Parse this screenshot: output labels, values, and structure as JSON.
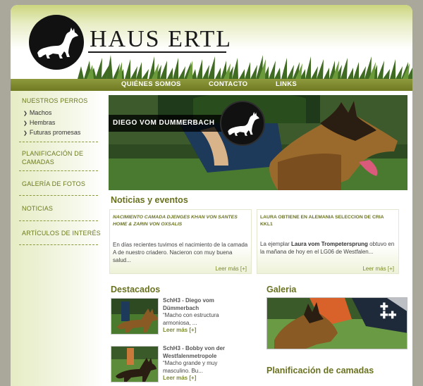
{
  "header": {
    "logo_text": "HAUS ERTL"
  },
  "nav": {
    "items": [
      "QUIÉNES SOMOS",
      "CONTACTO",
      "LINKS"
    ]
  },
  "sidebar": {
    "nuestros_perros": "NUESTROS PERROS",
    "subitems": [
      "Machos",
      "Hembras",
      "Futuras promesas"
    ],
    "planificacion_line1": "PLANIFICACIÓN DE",
    "planificacion_line2": "CAMADAS",
    "galeria": "GALERÍA DE FOTOS",
    "noticias": "NOTICIAS",
    "articulos": "ARTÍCULOS DE INTERÉS"
  },
  "hero": {
    "label": "DIEGO VOM DUMMERBACH"
  },
  "noticias": {
    "heading": "Noticias y eventos",
    "items": [
      {
        "title": "NACIMIENTO CAMADA DJENGES KHAN VON SANTES HOME & ZARIN VON OXSALIS",
        "body": "En días recientes tuvimos el nacimiento de la camada A de nuestro criadero.  Nacieron con muy buena salud...",
        "more": "Leer más [+]"
      },
      {
        "title": "LAURA OBTIENE EN ALEMANIA SELECCION DE CRIA KKL1",
        "body_pre": "La ejemplar ",
        "body_bold": "Laura vom Trompetersprung",
        "body_post": " obtuvo en la mañana de hoy en el LG06 de Westfalen...",
        "more": "Leer más [+]"
      }
    ]
  },
  "destacados": {
    "heading": "Destacados",
    "items": [
      {
        "name1": "SchH3 - Diego vom",
        "name2": "Dümmerbach",
        "desc1": "“Macho con estructura",
        "desc2": "armoniosa, ...",
        "more": "Leer más [+]"
      },
      {
        "name1": "SchH3 - Bobby von der",
        "name2": "Westfalenmetropole",
        "desc1": "“Macho grande y muy",
        "desc2": "masculino. Bu...",
        "more": "Leer más [+]"
      }
    ]
  },
  "galeria": {
    "heading": "Galeria"
  },
  "planificacion": {
    "heading": "Planificación de camadas"
  },
  "colors": {
    "accent": "#6a7220",
    "nav": "#7b8530"
  }
}
